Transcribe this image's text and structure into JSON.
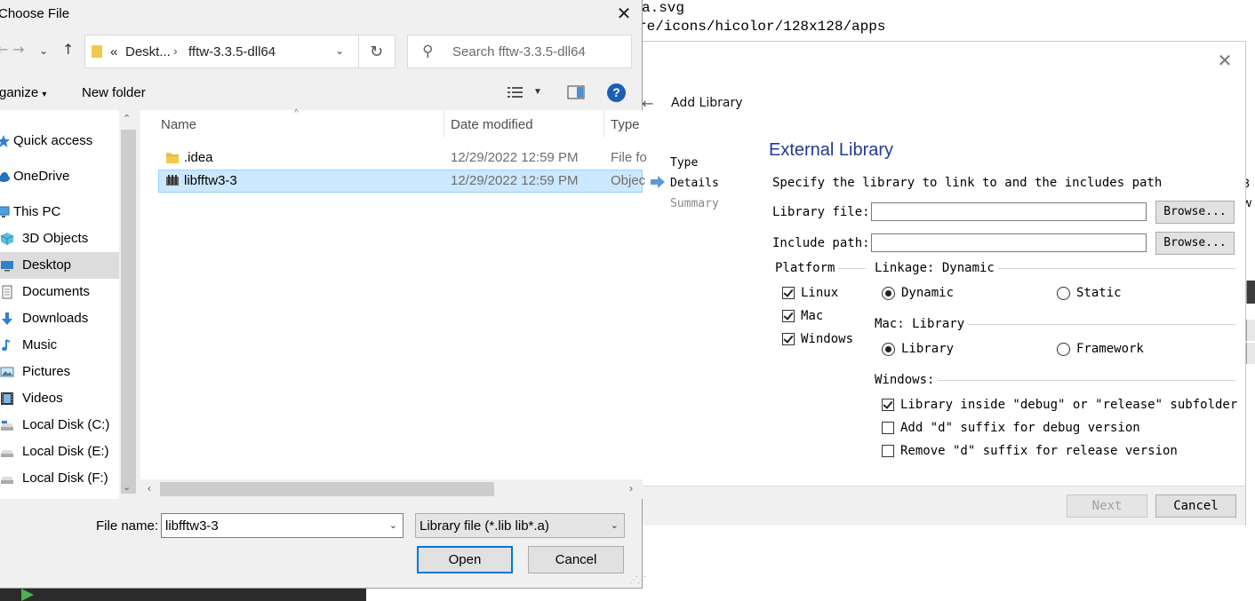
{
  "background": {
    "line1": "a.svg",
    "line2": "re/icons/hicolor/128x128/apps"
  },
  "add_library": {
    "back_icon": "arrow-left-icon",
    "title": "Add Library",
    "steps": [
      "Type",
      "Details",
      "Summary"
    ],
    "heading": "External Library",
    "description": "Specify the library to link to and the includes path",
    "library_file_label": "Library file:",
    "library_file_value": "",
    "include_path_label": "Include path:",
    "include_path_value": "",
    "browse_label": "Browse...",
    "platform": {
      "title": "Platform",
      "options": [
        {
          "label": "Linux",
          "checked": true
        },
        {
          "label": "Mac",
          "checked": true
        },
        {
          "label": "Windows",
          "checked": true
        }
      ]
    },
    "linkage": {
      "title": "Linkage: Dynamic",
      "options": [
        {
          "label": "Dynamic",
          "selected": true
        },
        {
          "label": "Static",
          "selected": false
        }
      ]
    },
    "mac": {
      "title": "Mac: Library",
      "options": [
        {
          "label": "Library",
          "selected": true
        },
        {
          "label": "Framework",
          "selected": false
        }
      ]
    },
    "windows": {
      "title": "Windows:",
      "options": [
        {
          "label": "Library inside \"debug\" or \"release\" subfolder",
          "checked": true
        },
        {
          "label": "Add \"d\" suffix for debug version",
          "checked": false
        },
        {
          "label": "Remove \"d\" suffix for release version",
          "checked": false
        }
      ]
    },
    "next_label": "Next",
    "cancel_label": "Cancel",
    "edge_text": [
      "3",
      "w"
    ]
  },
  "file_dialog": {
    "title": "Choose File",
    "breadcrumb": {
      "overflow": "«",
      "segments": [
        "Deskt...",
        "fftw-3.3.5-dll64"
      ]
    },
    "search_placeholder": "Search fftw-3.3.5-dll64",
    "organize_label": "ganize",
    "new_folder_label": "New folder",
    "help_label": "?",
    "nav_items": [
      {
        "label": "Quick access",
        "icon": "star-icon"
      },
      {
        "label": "OneDrive",
        "icon": "cloud-icon"
      },
      {
        "label": "This PC",
        "icon": "computer-icon"
      },
      {
        "label": "3D Objects",
        "icon": "cube-icon"
      },
      {
        "label": "Desktop",
        "icon": "desktop-icon",
        "selected": true
      },
      {
        "label": "Documents",
        "icon": "document-icon"
      },
      {
        "label": "Downloads",
        "icon": "download-icon"
      },
      {
        "label": "Music",
        "icon": "music-icon"
      },
      {
        "label": "Pictures",
        "icon": "picture-icon"
      },
      {
        "label": "Videos",
        "icon": "video-icon"
      },
      {
        "label": "Local Disk (C:)",
        "icon": "drive-icon"
      },
      {
        "label": "Local Disk (E:)",
        "icon": "drive-icon"
      },
      {
        "label": "Local Disk (F:)",
        "icon": "drive-icon"
      }
    ],
    "columns": {
      "name": "Name",
      "date": "Date modified",
      "type": "Type"
    },
    "files": [
      {
        "name": ".idea",
        "date": "12/29/2022 12:59 PM",
        "type": "File fo",
        "icon": "folder-icon",
        "selected": false
      },
      {
        "name": "libfftw3-3",
        "date": "12/29/2022 12:59 PM",
        "type": "Objec",
        "icon": "library-file-icon",
        "selected": true
      }
    ],
    "file_name_label": "File name:",
    "file_name_value": "libfftw3-3",
    "file_type_value": "Library file (*.lib lib*.a)",
    "open_label": "Open",
    "cancel_label": "Cancel"
  },
  "colors": {
    "accent": "#0078d7",
    "selection": "#cce8ff",
    "heading_blue": "#1f3a93",
    "help_blue": "#1a5fb4"
  }
}
